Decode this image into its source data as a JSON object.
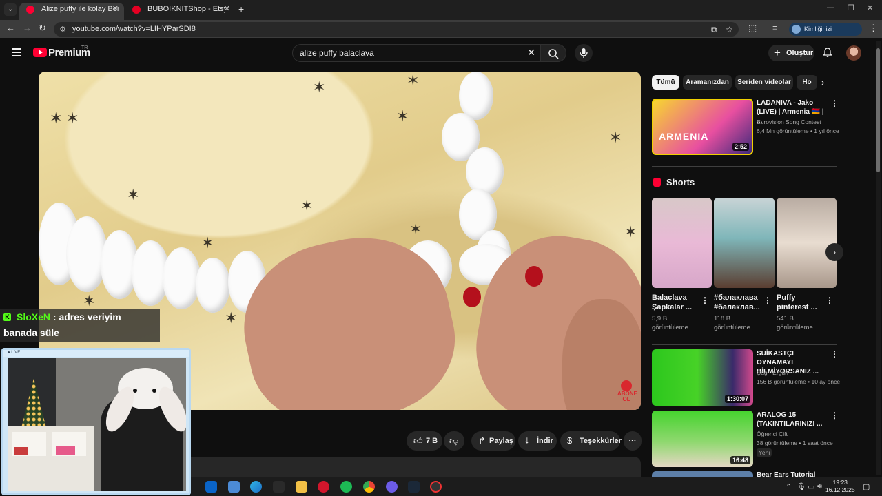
{
  "browser": {
    "tabs": [
      {
        "label": "Alize puffy ile kolay Bere yapımı",
        "close": "✕",
        "active": true
      },
      {
        "label": "BUBOIKNITShop - Etsy",
        "close": "✕",
        "active": false
      }
    ],
    "new_tab": "+",
    "url": "youtube.com/watch?v=LIHYParSDI8",
    "verify_label": "Kimliğinizi doğrulayın"
  },
  "youtube": {
    "logo_text": "Premium",
    "country": "TR",
    "search_query": "alize puffy balaclava",
    "create_label": "Oluştur",
    "actions": {
      "likes": "7 B",
      "share": "Paylaş",
      "download": "İndir",
      "thanks": "Teşekkürler",
      "more": "···"
    },
    "subscribe_badge": {
      "line1": "ABONE",
      "line2": "OL"
    },
    "chips": [
      "Tümü",
      "Aramanızdan",
      "Seriden videolar",
      "Ho"
    ],
    "recommendations_top": [
      {
        "title": "LADANIVA - Jako (LIVE) | Armenia 🇦🇲 | ...",
        "channel": "Eurovision Song Contest",
        "meta": "6,4 Mn görüntüleme • 1 yıl önce",
        "duration": "2:52",
        "thumb_text": "ARMENIA"
      }
    ],
    "shorts_heading": "Shorts",
    "shorts": [
      {
        "title": "Balaclava Şapkalar ...",
        "views": "5,9 B görüntüleme"
      },
      {
        "title": "#балаклава #балаклав...",
        "views": "118 B görüntüleme"
      },
      {
        "title": "Puffy pinterest ...",
        "views": "541 B görüntüleme"
      }
    ],
    "recommendations_bottom": [
      {
        "title": "SUİKASTÇI OYNAMAYI BİLMİYORSANIZ ...",
        "channel": "Çağrı Ergün",
        "meta": "156 B görüntüleme • 10 ay önce",
        "duration": "1:30:07"
      },
      {
        "title": "ARALOG 15 (TAKINTILARINIZI ...",
        "channel": "Öğrenci Çift",
        "meta": "38 görüntüleme • 1 saat önce",
        "duration": "16:48",
        "badge": "Yeni"
      },
      {
        "title": "Bear Ears Tutorial"
      }
    ]
  },
  "overlay": {
    "chat_user": "SloXeN",
    "chat_line1": ": adres veriyim",
    "chat_line2": "banada süle",
    "webcam_label": "● LIVE"
  },
  "taskbar": {
    "time": "19:23",
    "date": "16.12.2025"
  },
  "colors": {
    "accent_red": "#ff0033",
    "bg": "#0f0f0f",
    "chip_bg": "#272727",
    "kick_green": "#53fc18"
  }
}
